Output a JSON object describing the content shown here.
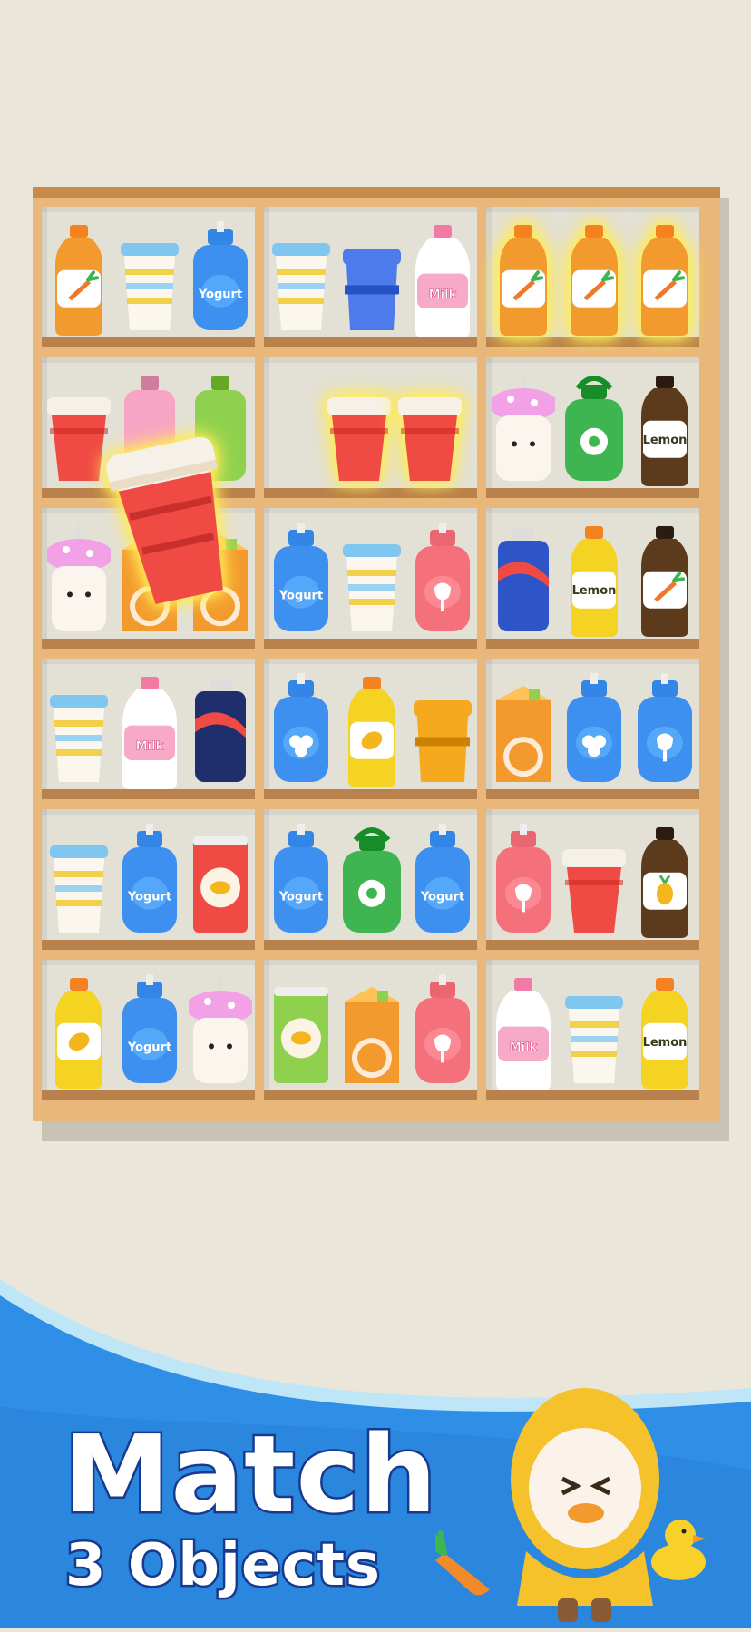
{
  "banner": {
    "line1": "Match",
    "line2": "3 Objects"
  },
  "colors": {
    "background": "#ebe6da",
    "shelf_wood": "#e9b779",
    "banner_blue": "#2f8fe6",
    "title_outline": "#173a8e",
    "match_glow": "#fff56b"
  },
  "shelf": {
    "columns": 3,
    "rows": 6,
    "cells": [
      {
        "items": [
          {
            "type": "juice",
            "label_icon": "carrot-icon",
            "color": "#f39a2e"
          },
          {
            "type": "cup",
            "color": "#7fc6f0"
          },
          {
            "type": "yogurt",
            "label": "Yogurt",
            "color": "#3d8ff0"
          }
        ]
      },
      {
        "items": [
          {
            "type": "cup",
            "color": "#7fc6f0"
          },
          {
            "type": "mug",
            "color": "#4d7bec"
          },
          {
            "type": "milk",
            "label": "Milk",
            "color": "#ffffff"
          }
        ]
      },
      {
        "items": [
          {
            "type": "juice",
            "label_icon": "carrot-icon",
            "color": "#f39a2e",
            "matched": true
          },
          {
            "type": "juice",
            "label_icon": "carrot-icon",
            "color": "#f39a2e",
            "matched": true
          },
          {
            "type": "juice",
            "label_icon": "carrot-icon",
            "color": "#f39a2e",
            "matched": true
          }
        ]
      },
      {
        "items": [
          {
            "type": "redcup",
            "color": "#ef4a44"
          },
          {
            "type": "bottle",
            "color": "#f7a5c4"
          },
          {
            "type": "bottle",
            "color": "#8fd14f"
          }
        ]
      },
      {
        "items": [
          {
            "type": "redcup",
            "color": "#ef4a44",
            "matched": true
          },
          {
            "type": "redcup",
            "color": "#ef4a44",
            "matched": true
          }
        ]
      },
      {
        "items": [
          {
            "type": "mushroom",
            "color": "#f3a1e6"
          },
          {
            "type": "jug",
            "label_icon": "flower-icon",
            "color": "#3fb552"
          },
          {
            "type": "juice",
            "label": "Lemon",
            "color": "#5c3a1c"
          }
        ]
      },
      {
        "items": [
          {
            "type": "mushroom",
            "color": "#f3a1e6"
          },
          {
            "type": "carton",
            "color": "#f39a2e"
          },
          {
            "type": "carton",
            "color": "#f39a2e"
          }
        ]
      },
      {
        "items": [
          {
            "type": "yogurt",
            "label": "Yogurt",
            "color": "#3d8ff0"
          },
          {
            "type": "cup",
            "color": "#7fc6f0"
          },
          {
            "type": "flask",
            "label_icon": "tulip-icon",
            "color": "#f4707a"
          }
        ]
      },
      {
        "items": [
          {
            "type": "soda",
            "color": "#2d55c8"
          },
          {
            "type": "juice",
            "label": "Lemon",
            "color": "#f5d323"
          },
          {
            "type": "juice",
            "label_icon": "carrot-icon",
            "color": "#5c3a1c"
          }
        ]
      },
      {
        "items": [
          {
            "type": "cup",
            "color": "#7fc6f0"
          },
          {
            "type": "milk",
            "label": "Milk",
            "color": "#ffffff"
          },
          {
            "type": "soda",
            "color": "#1f2f6e"
          }
        ]
      },
      {
        "items": [
          {
            "type": "flask",
            "label_icon": "clover-icon",
            "color": "#3d8ff0"
          },
          {
            "type": "juice",
            "label_icon": "mango-icon",
            "color": "#f5d323"
          },
          {
            "type": "mug",
            "color": "#f5a91f"
          }
        ]
      },
      {
        "items": [
          {
            "type": "carton",
            "color": "#f39a2e"
          },
          {
            "type": "flask",
            "label_icon": "clover-icon",
            "color": "#3d8ff0"
          },
          {
            "type": "flask",
            "label_icon": "tulip-icon",
            "color": "#3d8ff0"
          }
        ]
      },
      {
        "items": [
          {
            "type": "cup",
            "color": "#7fc6f0"
          },
          {
            "type": "yogurt",
            "label": "Yogurt",
            "color": "#3d8ff0"
          },
          {
            "type": "can",
            "label_icon": "chips-icon",
            "color": "#ef4a44"
          }
        ]
      },
      {
        "items": [
          {
            "type": "yogurt",
            "label": "Yogurt",
            "color": "#3d8ff0"
          },
          {
            "type": "jug",
            "label_icon": "flower-icon",
            "color": "#3fb552"
          },
          {
            "type": "yogurt",
            "label": "Yogurt",
            "color": "#3d8ff0"
          }
        ]
      },
      {
        "items": [
          {
            "type": "flask",
            "label_icon": "tulip-icon",
            "color": "#f4707a"
          },
          {
            "type": "redcup",
            "color": "#ef4a44"
          },
          {
            "type": "juice",
            "label_icon": "pineapple-icon",
            "color": "#5c3a1c"
          }
        ]
      },
      {
        "items": [
          {
            "type": "juice",
            "label_icon": "mango-icon",
            "color": "#f5d323"
          },
          {
            "type": "yogurt",
            "label": "Yogurt",
            "color": "#3d8ff0"
          },
          {
            "type": "mushroom",
            "color": "#f3a1e6"
          }
        ]
      },
      {
        "items": [
          {
            "type": "can",
            "label_icon": "chips-icon",
            "color": "#8fd14f"
          },
          {
            "type": "carton",
            "color": "#f39a2e"
          },
          {
            "type": "flask",
            "label_icon": "tulip-icon",
            "color": "#f4707a"
          }
        ]
      },
      {
        "items": [
          {
            "type": "milk",
            "label": "Milk",
            "color": "#ffffff"
          },
          {
            "type": "cup",
            "color": "#7fc6f0"
          },
          {
            "type": "juice",
            "label": "Lemon",
            "color": "#f5d323"
          }
        ]
      }
    ]
  },
  "held_item": {
    "type": "redcup",
    "color": "#ef4a44"
  }
}
